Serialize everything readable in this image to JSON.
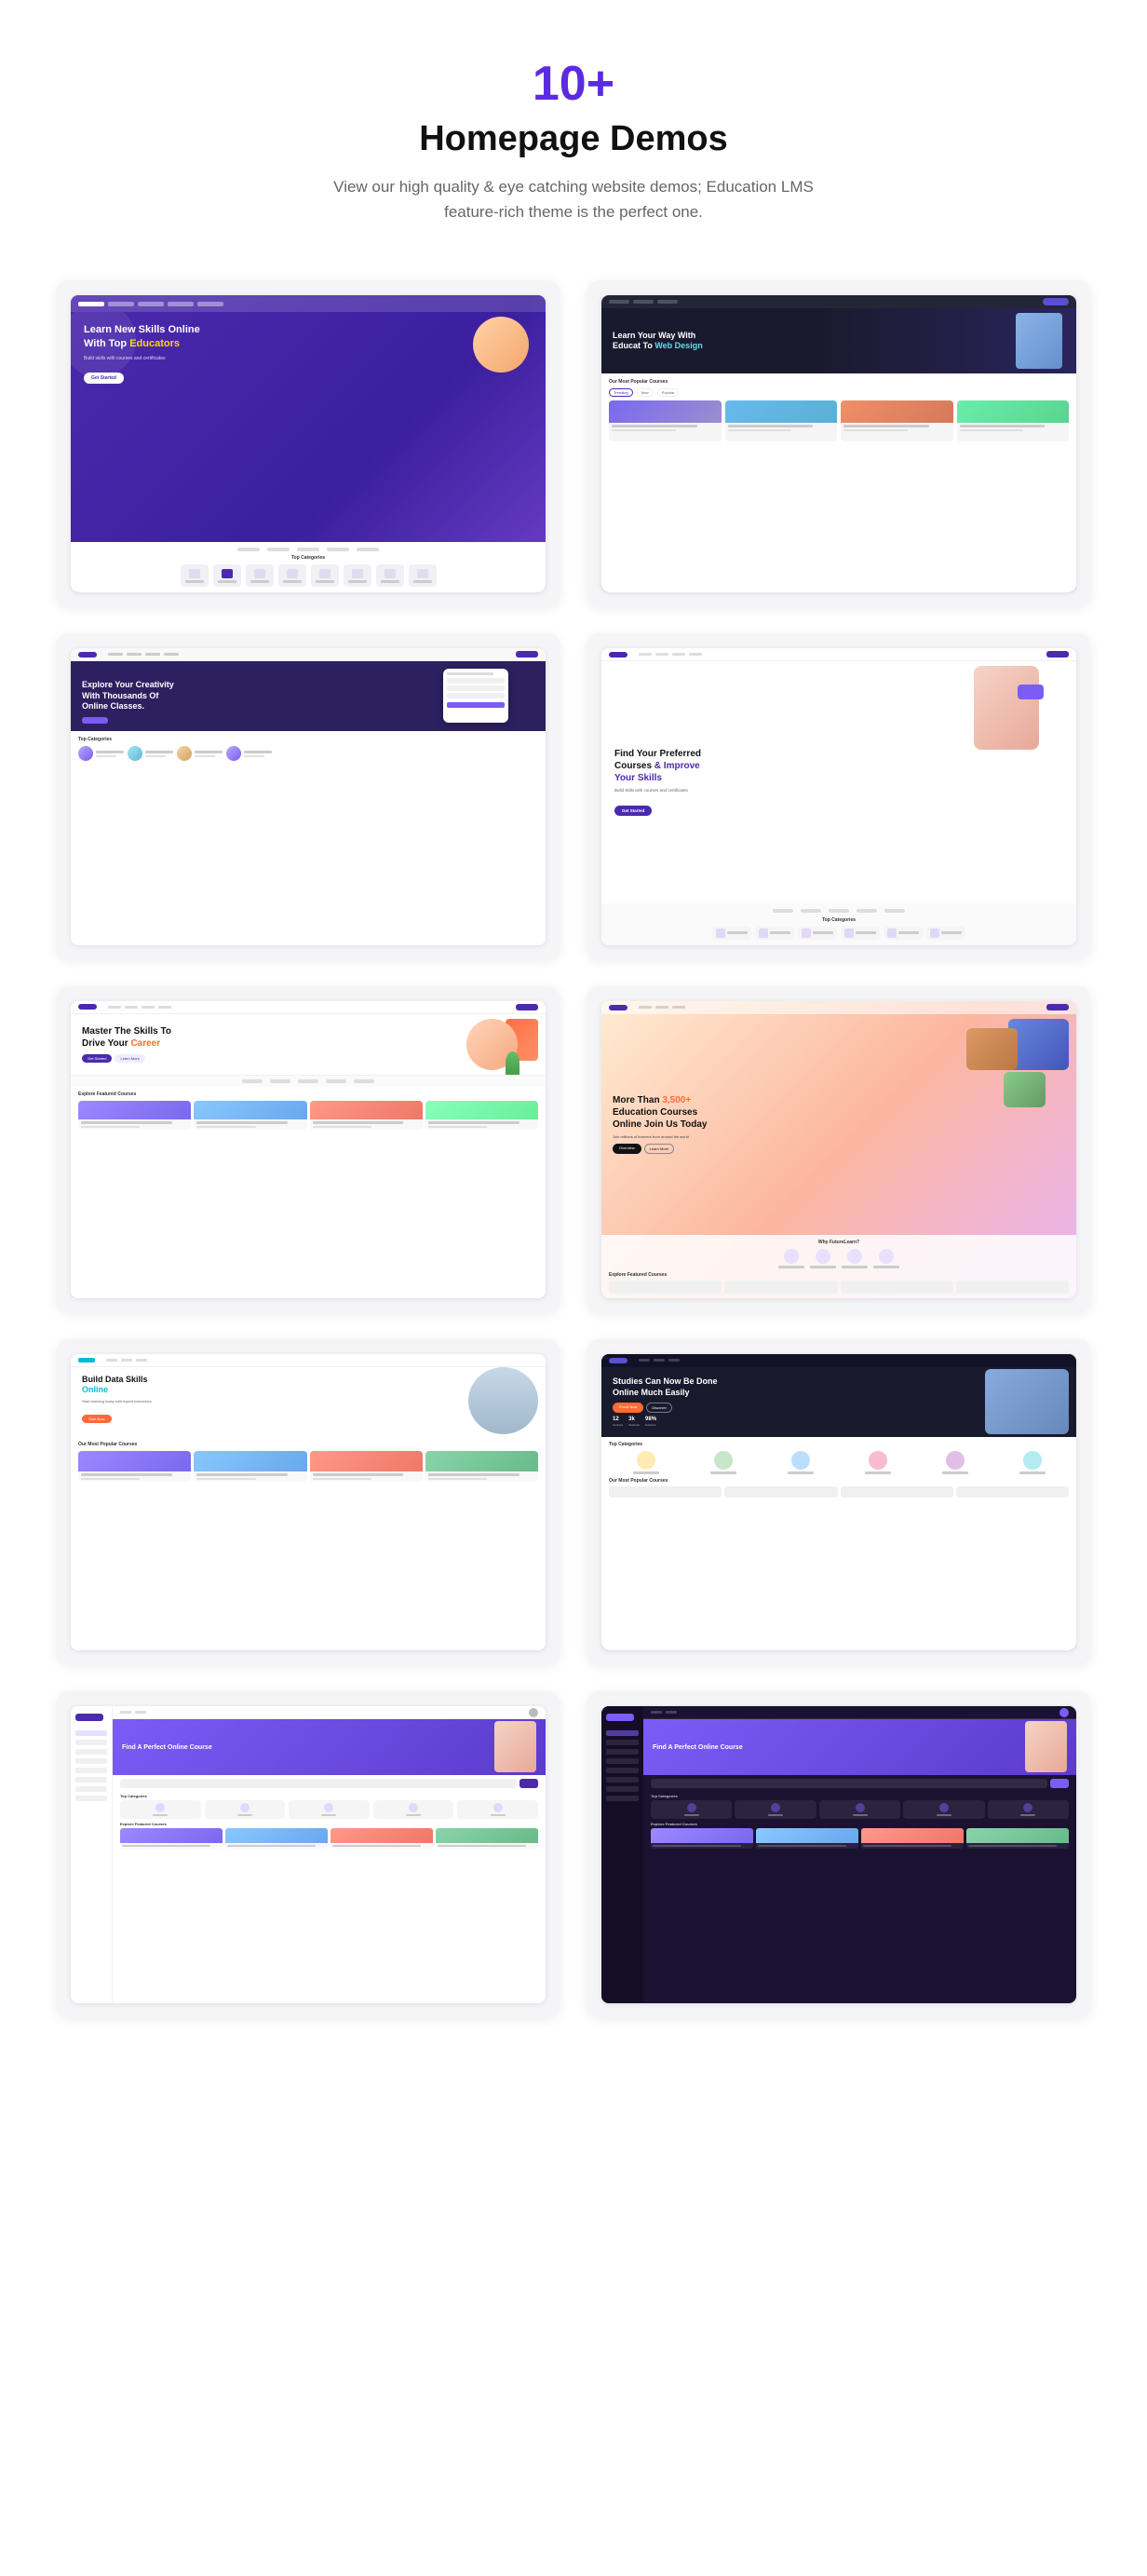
{
  "header": {
    "count": "10+",
    "title": "Homepage Demos",
    "description": "View our high quality & eye catching website demos; Education LMS feature-rich theme is the perfect one."
  },
  "demos": [
    {
      "id": "demo1",
      "title": "Learn New Skills Online With Top Educators",
      "highlight": "Educators",
      "style": "purple-hero"
    },
    {
      "id": "demo2",
      "title": "Learn Your Way With Educat To Web Design",
      "highlight": "Web Design",
      "style": "dark-web"
    },
    {
      "id": "demo3",
      "title": "Explore Your Creativity With Thousands Of Online Classes.",
      "style": "dark-creativity"
    },
    {
      "id": "demo4",
      "title": "Find Your Preferred Courses & Improve Your Skills",
      "highlight": "Courses & Improve Your Skills",
      "style": "find-courses"
    },
    {
      "id": "demo5",
      "title": "Master The Skills To Drive Your Career",
      "highlight": "Career",
      "style": "master-skills"
    },
    {
      "id": "demo6",
      "title": "More Than 3,500+ Education Courses Online Join Us Today",
      "highlight": "3,500+",
      "style": "gradient-hero"
    },
    {
      "id": "demo7",
      "title": "Build Data Skills Online",
      "highlight": "Online",
      "style": "data-skills"
    },
    {
      "id": "demo8",
      "title": "Studies Can Now Be Done Online Much Easily",
      "style": "dark-studies"
    },
    {
      "id": "demo9",
      "title": "Find A Perfect Online Course",
      "style": "lms-sidebar-light"
    },
    {
      "id": "demo10",
      "title": "Find A Perfect Online Course",
      "style": "lms-sidebar-dark"
    }
  ]
}
